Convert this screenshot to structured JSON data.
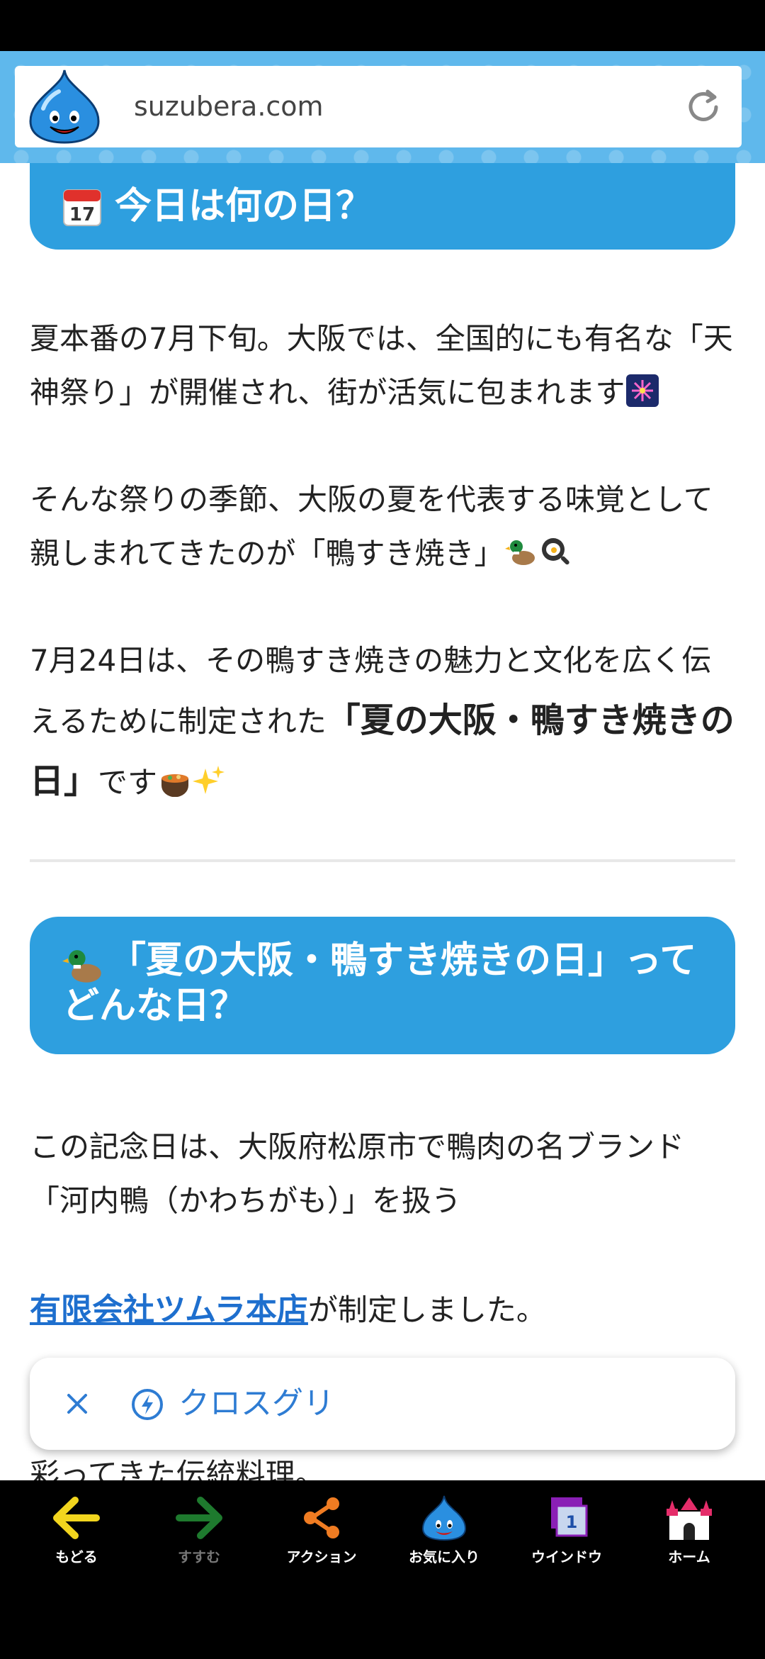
{
  "browser": {
    "url": "suzubera.com"
  },
  "article": {
    "heading1": "今日は何の日？",
    "p1": "夏本番の7月下旬。大阪では、全国的にも有名な「天神祭り」が開催され、街が活気に包まれます",
    "p2": "そんな祭りの季節、大阪の夏を代表する味覚として親しまれてきたのが「鴨すき焼き」",
    "p3_a": "7月24日は、その鴨すき焼きの魅力と文化を広く伝えるために制定された",
    "p3_bold": "「夏の大阪・鴨すき焼きの日」",
    "p3_b": "です",
    "heading2": "「夏の大阪・鴨すき焼きの日」ってどんな日？",
    "p4": "この記念日は、大阪府松原市で鴨肉の名ブランド「河内鴨（かわちがも）」を扱う",
    "p5_link": "有限会社ツムラ本店",
    "p5_rest": "が制定しました。",
    "cut_line": "彩ってきた伝統料理。"
  },
  "popup": {
    "label": "クロスグリ"
  },
  "nav": {
    "back": "もどる",
    "forward": "すすむ",
    "action": "アクション",
    "favorites": "お気に入り",
    "window": "ウインドウ",
    "window_count": "1",
    "home": "ホーム"
  },
  "colors": {
    "accent": "#2e9fdf",
    "link": "#1e6fce",
    "urlbar_bg": "#5fb8ec"
  },
  "icons": [
    "slime-logo-icon",
    "reload-icon",
    "calendar-icon",
    "fireworks-icon",
    "duck-icon",
    "frying-pan-icon",
    "stew-pot-icon",
    "sparkles-icon",
    "close-icon",
    "lightning-icon",
    "back-arrow-icon",
    "forward-arrow-icon",
    "share-icon",
    "slime-icon",
    "window-icon",
    "castle-icon"
  ]
}
